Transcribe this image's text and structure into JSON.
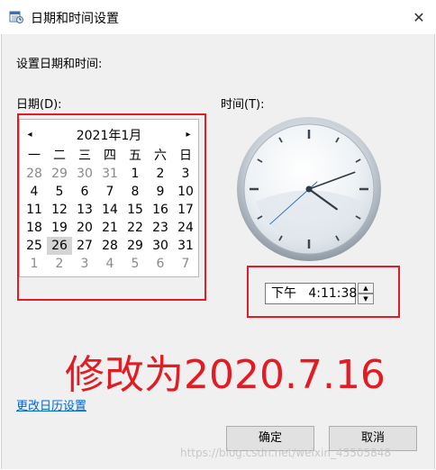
{
  "window": {
    "title": "日期和时间设置",
    "close_glyph": "✕"
  },
  "instruction": "设置日期和时间:",
  "date_label": "日期(D):",
  "time_label": "时间(T):",
  "calendar": {
    "month_title": "2021年1月",
    "prev_glyph": "◂",
    "next_glyph": "▸",
    "weekdays": [
      "一",
      "二",
      "三",
      "四",
      "五",
      "六",
      "日"
    ],
    "weeks": [
      [
        {
          "d": "28",
          "o": true
        },
        {
          "d": "29",
          "o": true
        },
        {
          "d": "30",
          "o": true
        },
        {
          "d": "31",
          "o": true
        },
        {
          "d": "1"
        },
        {
          "d": "2"
        },
        {
          "d": "3"
        }
      ],
      [
        {
          "d": "4"
        },
        {
          "d": "5"
        },
        {
          "d": "6"
        },
        {
          "d": "7"
        },
        {
          "d": "8"
        },
        {
          "d": "9"
        },
        {
          "d": "10"
        }
      ],
      [
        {
          "d": "11"
        },
        {
          "d": "12"
        },
        {
          "d": "13"
        },
        {
          "d": "14"
        },
        {
          "d": "15"
        },
        {
          "d": "16"
        },
        {
          "d": "17"
        }
      ],
      [
        {
          "d": "18"
        },
        {
          "d": "19"
        },
        {
          "d": "20"
        },
        {
          "d": "21"
        },
        {
          "d": "22"
        },
        {
          "d": "23"
        },
        {
          "d": "24"
        }
      ],
      [
        {
          "d": "25"
        },
        {
          "d": "26",
          "sel": true
        },
        {
          "d": "27"
        },
        {
          "d": "28"
        },
        {
          "d": "29"
        },
        {
          "d": "30"
        },
        {
          "d": "31"
        }
      ],
      [
        {
          "d": "1",
          "o": true
        },
        {
          "d": "2",
          "o": true
        },
        {
          "d": "3",
          "o": true
        },
        {
          "d": "4",
          "o": true
        },
        {
          "d": "5",
          "o": true
        },
        {
          "d": "6",
          "o": true
        },
        {
          "d": "7",
          "o": true
        }
      ]
    ]
  },
  "clock": {
    "hour": 4,
    "minute": 11,
    "second": 38
  },
  "time_field": {
    "value": "下午   4:11:38",
    "up_glyph": "▲",
    "down_glyph": "▼"
  },
  "annotation": "修改为2020.7.16",
  "change_calendar_link": "更改日历设置",
  "buttons": {
    "ok": "确定",
    "cancel": "取消"
  },
  "watermark": "https://blog.csdn.net/weixin_45505848",
  "colors": {
    "highlight_red": "#e31b23",
    "link_blue": "#0066cc",
    "selected_day_bg": "#d4d4d4"
  },
  "icons": {
    "title": "calendar-clock-icon"
  }
}
